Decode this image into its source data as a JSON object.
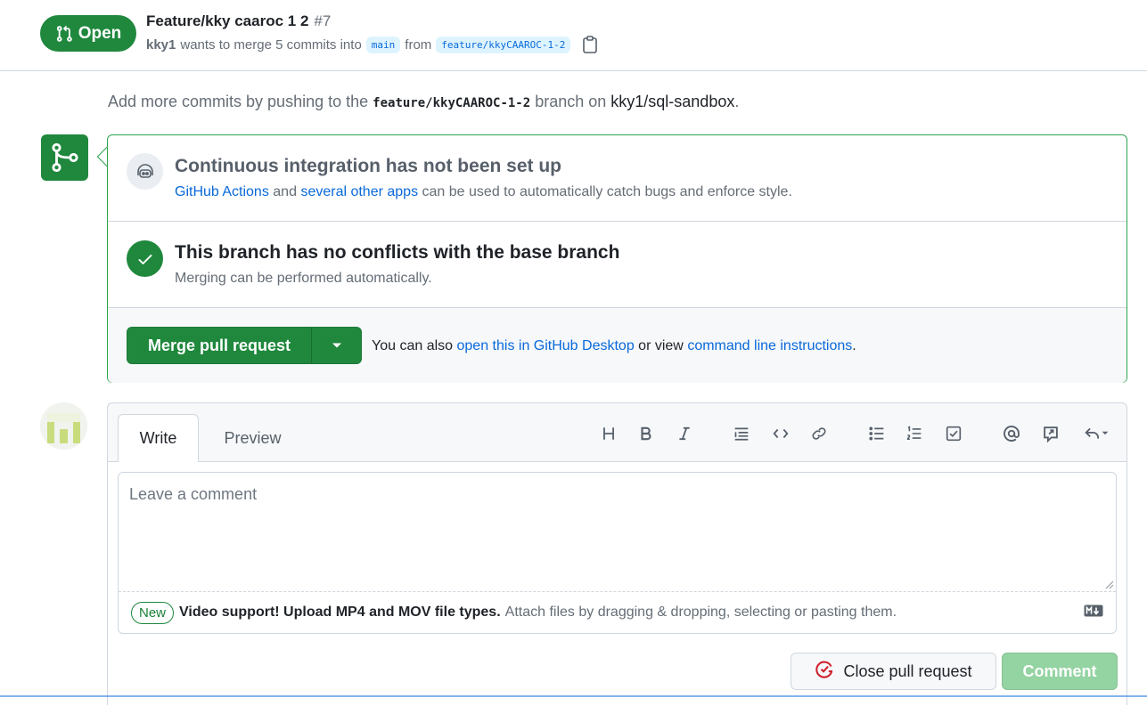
{
  "header": {
    "state_label": "Open",
    "title": "Feature/kky caaroc 1 2",
    "number": "#7",
    "author": "kky1",
    "meta_text": "wants to merge 5 commits into",
    "base_branch": "main",
    "from_text": "from",
    "head_branch": "feature/kkyCAAROC-1-2"
  },
  "push_hint": {
    "prefix": "Add more commits by pushing to the",
    "branch": "feature/kkyCAAROC-1-2",
    "middle": "branch on",
    "repo": "kky1/sql-sandbox",
    "suffix": "."
  },
  "merge_box": {
    "ci_title": "Continuous integration has not been set up",
    "ci_link1": "GitHub Actions",
    "ci_and": "and",
    "ci_link2": "several other apps",
    "ci_rest": "can be used to automatically catch bugs and enforce style.",
    "conflicts_title": "This branch has no conflicts with the base branch",
    "conflicts_desc": "Merging can be performed automatically.",
    "merge_button": "Merge pull request",
    "also_prefix": "You can also",
    "also_link1": "open this in GitHub Desktop",
    "also_middle": "or view",
    "also_link2": "command line instructions",
    "also_suffix": "."
  },
  "comment": {
    "tab_write": "Write",
    "tab_preview": "Preview",
    "placeholder": "Leave a comment",
    "new_badge": "New",
    "video_support": "Video support! Upload MP4 and MOV file types.",
    "attach_text": "Attach files by dragging & dropping, selecting or pasting them.",
    "close_button": "Close pull request",
    "comment_button": "Comment"
  },
  "toolbar_icons": [
    "heading-icon",
    "bold-icon",
    "italic-icon",
    "quote-icon",
    "code-icon",
    "link-icon",
    "unordered-list-icon",
    "ordered-list-icon",
    "task-list-icon",
    "mention-icon",
    "reference-icon",
    "saved-replies-icon"
  ],
  "colors": {
    "accent_green": "#1f883d",
    "link_blue": "#0969da",
    "muted_text": "#656d76"
  }
}
